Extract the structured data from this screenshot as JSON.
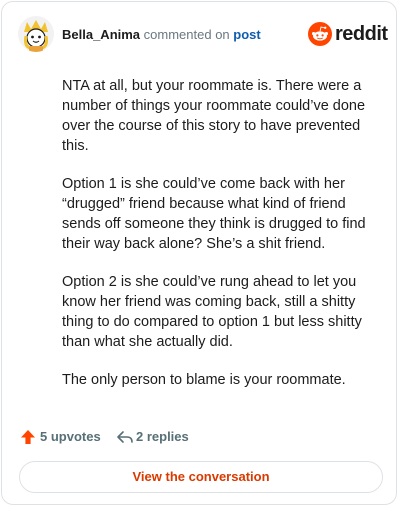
{
  "comment": {
    "username": "Bella_Anima",
    "action_text": "commented on",
    "target_text": "post",
    "paragraphs": [
      "NTA at all, but your roommate is. There were a number of things your roommate could’ve done over the course of this story to have prevented this.",
      "Option 1 is she could’ve come back with her “drugged” friend because what kind of friend sends off someone they think is drugged to find their way back alone? She’s a shit friend.",
      "Option 2 is she could’ve rung ahead to let you know her friend was coming back, still a shitty thing to do compared to option 1 but less shitty than what she actually did.",
      "The only person to blame is your roommate."
    ]
  },
  "brand": {
    "name": "reddit",
    "accent_color": "#ff4500",
    "icon": "reddit-snoo-icon"
  },
  "footer": {
    "upvotes_label": "5 upvotes",
    "replies_label": "2 replies",
    "upvote_icon": "upvote-arrow-icon",
    "reply_icon": "reply-arrow-icon"
  },
  "cta": {
    "label": "View the conversation",
    "color": "#d93a00"
  }
}
